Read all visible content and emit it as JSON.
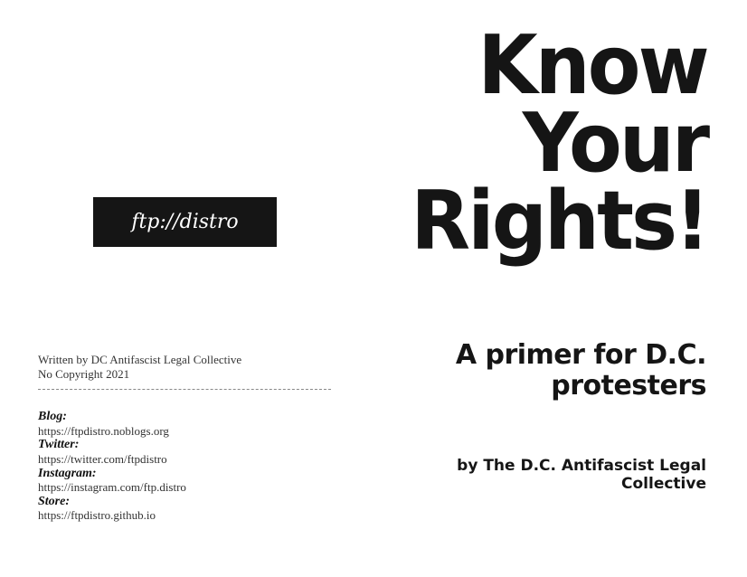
{
  "logo": "ftp://distro",
  "credits": {
    "written_by": "Written by DC Antifascist Legal Collective",
    "copyright": "No Copyright 2021"
  },
  "links": [
    {
      "label": "Blog:",
      "url": "https://ftpdistro.noblogs.org"
    },
    {
      "label": "Twitter:",
      "url": "https://twitter.com/ftpdistro"
    },
    {
      "label": "Instagram:",
      "url": "https://instagram.com/ftp.distro"
    },
    {
      "label": "Store:",
      "url": "https://ftpdistro.github.io"
    }
  ],
  "title": [
    "Know",
    "Your",
    "Rights!"
  ],
  "subtitle": [
    "A primer for D.C.",
    "protesters"
  ],
  "byline": [
    "by The D.C. Antifascist Legal",
    "Collective"
  ]
}
